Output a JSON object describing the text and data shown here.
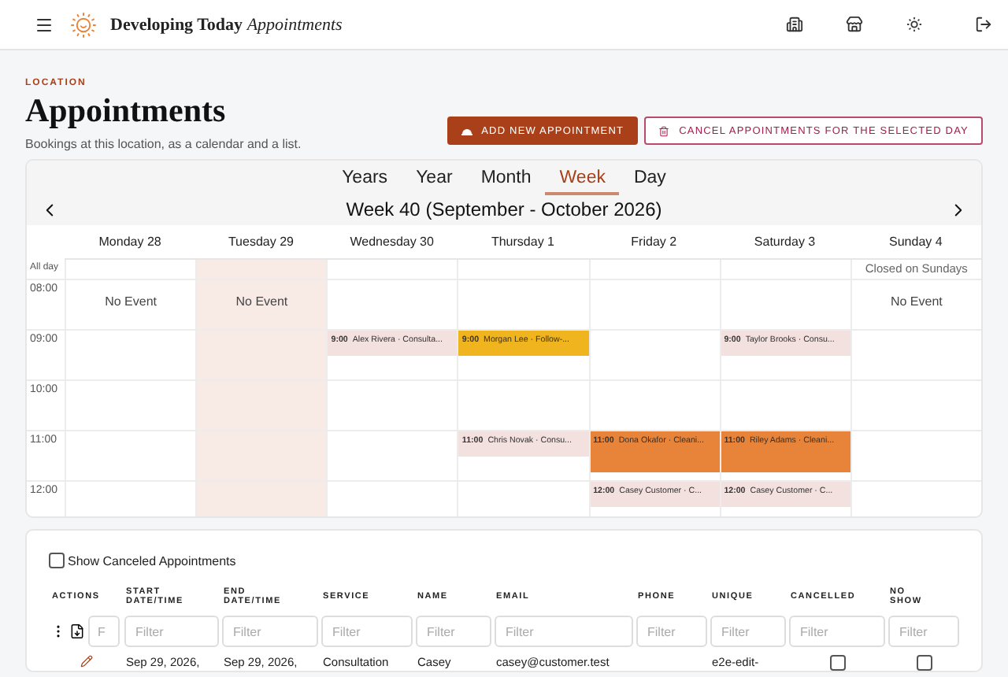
{
  "brand": {
    "name": "Developing Today",
    "product": "Appointments"
  },
  "page": {
    "eyebrow": "LOCATION",
    "title": "Appointments",
    "subtitle": "Bookings at this location, as a calendar and a list."
  },
  "actions": [
    {
      "label": "ADD NEW APPOINTMENT",
      "kind": "primary"
    },
    {
      "label": "CANCEL APPOINTMENTS FOR THE SELECTED DAY",
      "kind": "danger"
    }
  ],
  "views": [
    {
      "label": "Years",
      "selected": false
    },
    {
      "label": "Year",
      "selected": false
    },
    {
      "label": "Month",
      "selected": false
    },
    {
      "label": "Week",
      "selected": true
    },
    {
      "label": "Day",
      "selected": false
    }
  ],
  "week_title": "Week 40 (September - October 2026)",
  "days": [
    {
      "label": "Monday 28",
      "selected": false
    },
    {
      "label": "Tuesday 29",
      "selected": true
    },
    {
      "label": "Wednesday 30",
      "selected": false
    },
    {
      "label": "Thursday 1",
      "selected": false
    },
    {
      "label": "Friday 2",
      "selected": false
    },
    {
      "label": "Saturday 3",
      "selected": false
    },
    {
      "label": "Sunday 4",
      "selected": false
    }
  ],
  "all_day": {
    "label": "All day",
    "cells": [
      {
        "kind": "empty"
      },
      {
        "kind": "empty"
      },
      {
        "kind": "empty"
      },
      {
        "kind": "empty"
      },
      {
        "kind": "empty"
      },
      {
        "kind": "empty"
      },
      {
        "kind": "closed",
        "text": "Closed on Sundays"
      }
    ]
  },
  "rows": [
    {
      "hour": "08:00",
      "cells": [
        {
          "kind": "no-event",
          "text": "No Event"
        },
        {
          "kind": "no-event",
          "text": "No Event"
        },
        {
          "kind": "empty"
        },
        {
          "kind": "empty"
        },
        {
          "kind": "empty"
        },
        {
          "kind": "empty"
        },
        {
          "kind": "no-event",
          "text": "No Event"
        }
      ]
    },
    {
      "hour": "09:00",
      "cells": [
        {
          "kind": "empty"
        },
        {
          "kind": "empty"
        },
        {
          "kind": "event",
          "time": "9:00",
          "title": "Alex Rivera · Consulta...",
          "color": "#f3e1df"
        },
        {
          "kind": "event",
          "time": "9:00",
          "title": "Morgan Lee · Follow-...",
          "color": "#f0b41e"
        },
        {
          "kind": "empty"
        },
        {
          "kind": "event",
          "time": "9:00",
          "title": "Taylor Brooks · Consu...",
          "color": "#f3e1df"
        },
        {
          "kind": "empty"
        }
      ]
    },
    {
      "hour": "10:00",
      "cells": [
        {
          "kind": "empty"
        },
        {
          "kind": "empty"
        },
        {
          "kind": "empty"
        },
        {
          "kind": "empty"
        },
        {
          "kind": "empty"
        },
        {
          "kind": "empty"
        },
        {
          "kind": "empty"
        }
      ]
    },
    {
      "hour": "11:00",
      "cells": [
        {
          "kind": "empty"
        },
        {
          "kind": "empty"
        },
        {
          "kind": "empty"
        },
        {
          "kind": "event",
          "time": "11:00",
          "title": "Chris Novak · Consu...",
          "color": "#f3e1df"
        },
        {
          "kind": "long-event",
          "time": "11:00",
          "title": "Dona Okafor · Cleani...",
          "color": "#e8843a"
        },
        {
          "kind": "long-event",
          "time": "11:00",
          "title": "Riley Adams · Cleani...",
          "color": "#e8843a"
        },
        {
          "kind": "empty"
        }
      ]
    },
    {
      "hour": "12:00",
      "cells": [
        {
          "kind": "empty"
        },
        {
          "kind": "empty"
        },
        {
          "kind": "empty"
        },
        {
          "kind": "empty"
        },
        {
          "kind": "event",
          "time": "12:00",
          "title": "Casey Customer · C...",
          "color": "#f3e1df"
        },
        {
          "kind": "event",
          "time": "12:00",
          "title": "Casey Customer · C...",
          "color": "#f3e1df"
        },
        {
          "kind": "empty"
        }
      ]
    }
  ],
  "show_canceled": {
    "label": "Show Canceled Appointments",
    "checked": false
  },
  "table": {
    "columns": [
      "ACTIONS",
      "START DATE/TIME",
      "END DATE/TIME",
      "SERVICE",
      "NAME",
      "EMAIL",
      "PHONE",
      "UNIQUE",
      "CANCELLED",
      "NO SHOW"
    ],
    "filters": [
      {
        "placeholder": "F"
      },
      {
        "placeholder": "Filter"
      },
      {
        "placeholder": "Filter"
      },
      {
        "placeholder": "Filter"
      },
      {
        "placeholder": "Filter"
      },
      {
        "placeholder": "Filter"
      },
      {
        "placeholder": "Filter"
      },
      {
        "placeholder": "Filter"
      },
      {
        "placeholder": "Filter"
      },
      {
        "placeholder": "Filter"
      }
    ],
    "rows": [
      {
        "start": "Sep 29, 2026,",
        "end": "Sep 29, 2026,",
        "service": "Consultation",
        "name": "Casey",
        "email": "casey@customer.test",
        "unique": "e2e-edit-",
        "cancelled": false,
        "no_show": false
      }
    ]
  }
}
